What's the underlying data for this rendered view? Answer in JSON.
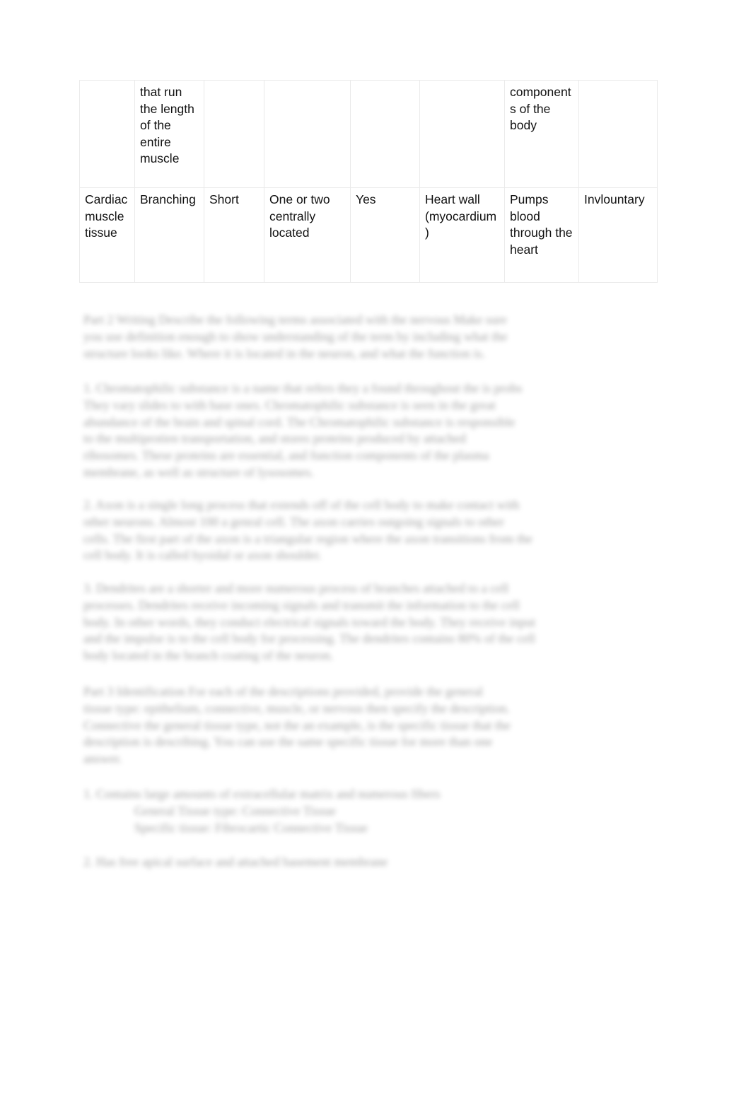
{
  "document": {
    "page_background": "#ffffff",
    "text_color": "#111111",
    "table_border_color": "#eaeaea"
  },
  "table": {
    "name": "muscle-tissue-comparison-table",
    "column_count": 8,
    "rows": [
      {
        "type": "continued-row",
        "cells": [
          "",
          "that run the length of the entire muscle",
          "",
          "",
          "",
          "",
          "components of the body",
          ""
        ]
      },
      {
        "type": "cardiac-row",
        "cells": [
          "Cardiac muscle tissue",
          "Branching",
          "Short",
          "One or two centrally located",
          "Yes",
          "Heart wall (myocardium)",
          "Pumps blood through the heart",
          "Invlountary"
        ]
      }
    ]
  },
  "body": {
    "part2": {
      "heading_label": "Part 2",
      "heading_sub": "Writing",
      "lines": [
        "Part 2   Writing     Describe the following terms associated with the nervous           Make sure",
        "you use definition enough to show understanding of the term by including what the",
        "structure looks like. Where it is located in the neuron, and what the function is."
      ]
    },
    "question1": {
      "number": "1.",
      "lines": [
        "1.   Chromatophilic substance is a name that refers they a found throughout the is probs",
        "They vary slides to with base ones. Chromatophilic substance is seen in the great",
        "abundance of the brain and spinal cord. The Chromatophilic substance is responsible",
        "to the multiprotien  transportation, and stores proteins produced by  attached",
        "ribosomes. These proteins are essential, and function components of the plasma",
        "membrane, as well as structure of lysosomes."
      ]
    },
    "question2": {
      "number": "2.",
      "lines": [
        "2.   Axon is a single long process that extends off of the cell body to make contact with",
        "other neurons. Almost  100  a genral cell.  The axon carries outgoing signals to other",
        "cells. The first part of the axon is a triangular region where the axon transitions from the",
        "cell body. It is called hyoidal or axon shoulder."
      ]
    },
    "question3": {
      "number": "3.",
      "lines": [
        "3.   Dendrites are a shorter and more numerous process of branches attached to a cell",
        "processes. Dendrites receive incoming signals and transmit the information to the cell",
        "body. In other words, they conduct electrical signals toward the body. They receive input",
        "and the impulse is to the cell body for processing. The dendrites contains 80% of the cell",
        "body located in the branch coating of the neuron."
      ]
    },
    "part3": {
      "heading_label": "Part 3",
      "heading_sub": "Identification",
      "lines": [
        "Part 3   Identification        For each of the descriptions provided, provide the general",
        "tissue type: epithelium, connective, muscle, or nervous then specify the description.",
        "Connective the general tissue type, not the an example, is the specific tissue that the",
        "description is describing.        You can use the same specific tissue for more than one",
        "answer."
      ]
    },
    "item1": {
      "prompt": "1. Contains large amounts of extracellular matrix and numerous fibers",
      "answer_general": "General Tissue type:  Connective Tissue",
      "answer_specific": "Specific tissue: Fibrocartic Connective Tissue"
    },
    "item2": {
      "prompt": "2. Has free apical surface and attached basement membrane"
    }
  }
}
